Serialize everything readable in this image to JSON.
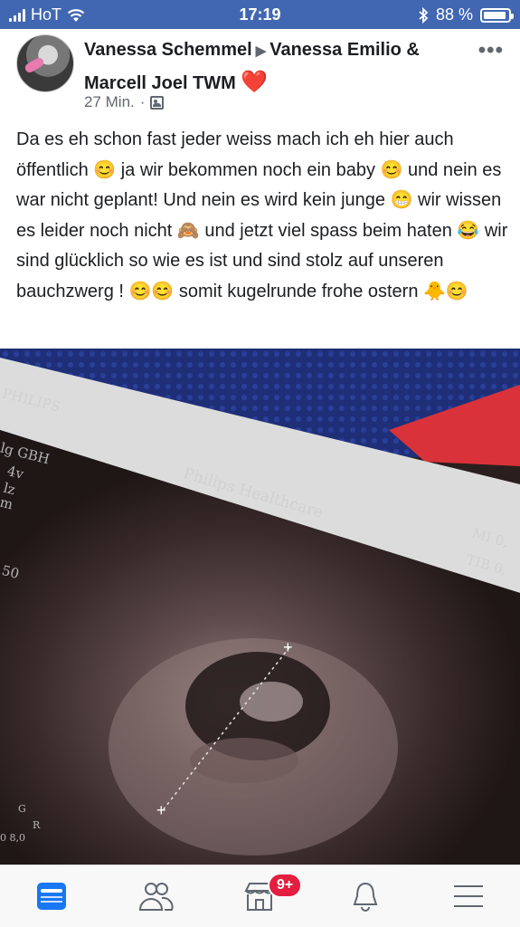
{
  "status_bar": {
    "carrier": "HoT",
    "time": "17:19",
    "battery": "88 %",
    "battery_level": 0.88
  },
  "post": {
    "author": "Vanessa Schemmel",
    "target": "Vanessa Emilio & Marcell Joel TWM",
    "heart": "❤️",
    "time": "27 Min.",
    "separator": "·",
    "audience_icon": "group-icon",
    "more_icon": "more-options-icon",
    "text": "Da es eh schon fast jeder weiss mach ich eh hier auch öffentlich 😊 ja wir bekommen noch ein baby 😊 und nein es war nicht geplant! Und nein es wird kein junge 😁 wir wissen es leider noch nicht 🙈 und jetzt viel spass beim haten 😂 wir sind glücklich so wie es ist und sind stolz auf unseren bauchzwerg ! 😊😊 somit kugelrunde frohe ostern 🐥😊"
  },
  "photo": {
    "brand_top": "PHILIPS",
    "brand_main": "Philips Healthcare",
    "left_labels": [
      "lg GBH",
      "4v",
      "lz",
      "m",
      "50"
    ],
    "right_labels": [
      "MI 0,",
      "TIB 0,"
    ],
    "bottom_labels": [
      "G",
      "R",
      "0 8,0"
    ]
  },
  "tabbar": {
    "items": [
      {
        "icon": "news-feed-icon",
        "active": true
      },
      {
        "icon": "friends-icon",
        "active": false
      },
      {
        "icon": "marketplace-icon",
        "active": false
      },
      {
        "icon": "notifications-icon",
        "active": false
      },
      {
        "icon": "menu-icon",
        "active": false
      }
    ],
    "badge": "9+"
  },
  "colors": {
    "brand": "#4267b2",
    "active_tab": "#1877f2",
    "badge": "#e41e3f"
  }
}
